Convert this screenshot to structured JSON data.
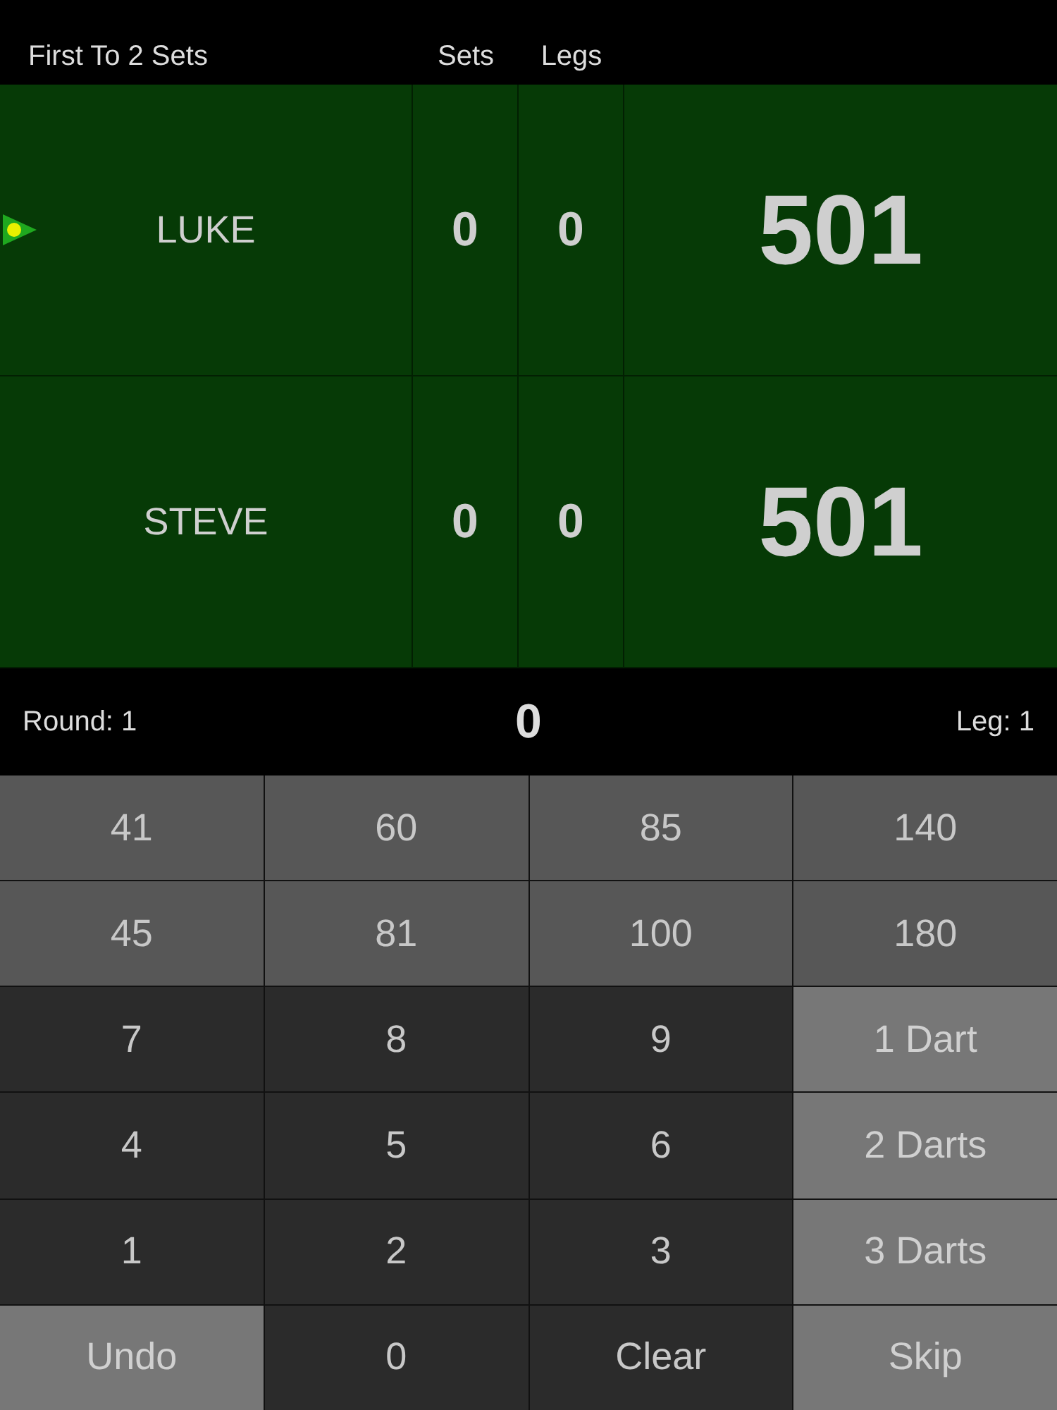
{
  "header": {
    "match_format": "First To 2 Sets",
    "sets_label": "Sets",
    "legs_label": "Legs"
  },
  "players": [
    {
      "name": "LUKE",
      "sets": "0",
      "legs": "0",
      "score": "501",
      "active": true
    },
    {
      "name": "STEVE",
      "sets": "0",
      "legs": "0",
      "score": "501",
      "active": false
    }
  ],
  "status_bar": {
    "round": "Round: 1",
    "current_total": "0",
    "leg": "Leg: 1"
  },
  "keypad": [
    {
      "label": "41",
      "kind": "preset"
    },
    {
      "label": "60",
      "kind": "preset"
    },
    {
      "label": "85",
      "kind": "preset"
    },
    {
      "label": "140",
      "kind": "preset"
    },
    {
      "label": "45",
      "kind": "preset"
    },
    {
      "label": "81",
      "kind": "preset"
    },
    {
      "label": "100",
      "kind": "preset"
    },
    {
      "label": "180",
      "kind": "preset"
    },
    {
      "label": "7",
      "kind": "digit"
    },
    {
      "label": "8",
      "kind": "digit"
    },
    {
      "label": "9",
      "kind": "digit"
    },
    {
      "label": "1 Dart",
      "kind": "option"
    },
    {
      "label": "4",
      "kind": "digit"
    },
    {
      "label": "5",
      "kind": "digit"
    },
    {
      "label": "6",
      "kind": "digit"
    },
    {
      "label": "2 Darts",
      "kind": "option"
    },
    {
      "label": "1",
      "kind": "digit"
    },
    {
      "label": "2",
      "kind": "digit"
    },
    {
      "label": "3",
      "kind": "digit"
    },
    {
      "label": "3 Darts",
      "kind": "option"
    },
    {
      "label": "Undo",
      "kind": "option"
    },
    {
      "label": "0",
      "kind": "digit"
    },
    {
      "label": "Clear",
      "kind": "action"
    },
    {
      "label": "Skip",
      "kind": "option"
    }
  ]
}
